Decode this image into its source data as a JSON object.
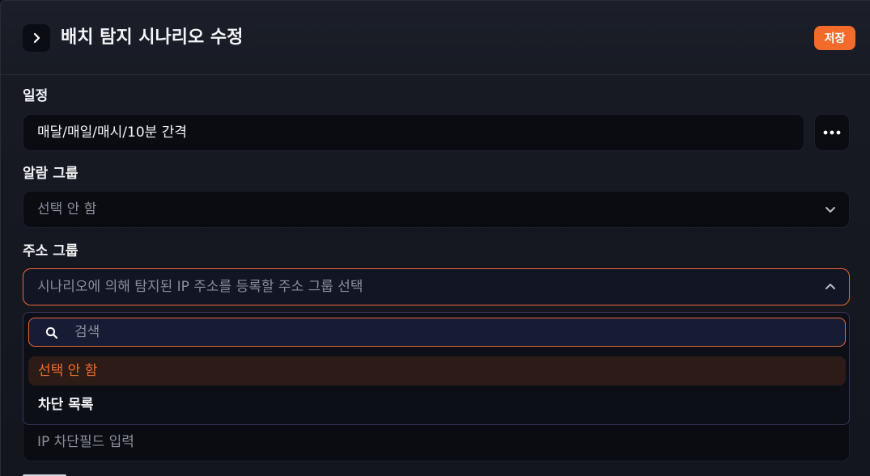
{
  "header": {
    "title": "배치 탐지 시나리오 수정",
    "save_label": "저장",
    "collapse_icon": "chevron-right-icon"
  },
  "schedule": {
    "label": "일정",
    "value": "매달/매일/매시/10분 간격",
    "more_icon": "more-horizontal-icon"
  },
  "alarm_group": {
    "label": "알람 그룹",
    "value": "선택 안 함"
  },
  "address_group": {
    "label": "주소 그룹",
    "placeholder": "시나리오에 의해 탐지된 IP 주소를 등록할 주소 그룹 선택",
    "dropdown": {
      "search_placeholder": "검색",
      "options": [
        {
          "label": "선택 안 함",
          "selected": true
        },
        {
          "label": "차단 목록",
          "selected": false
        }
      ]
    }
  },
  "ip_block_field": {
    "placeholder": "IP 차단필드 입력"
  },
  "colors": {
    "accent": "#f26b2a",
    "background": "#14161e",
    "field": "#0a0c12"
  }
}
